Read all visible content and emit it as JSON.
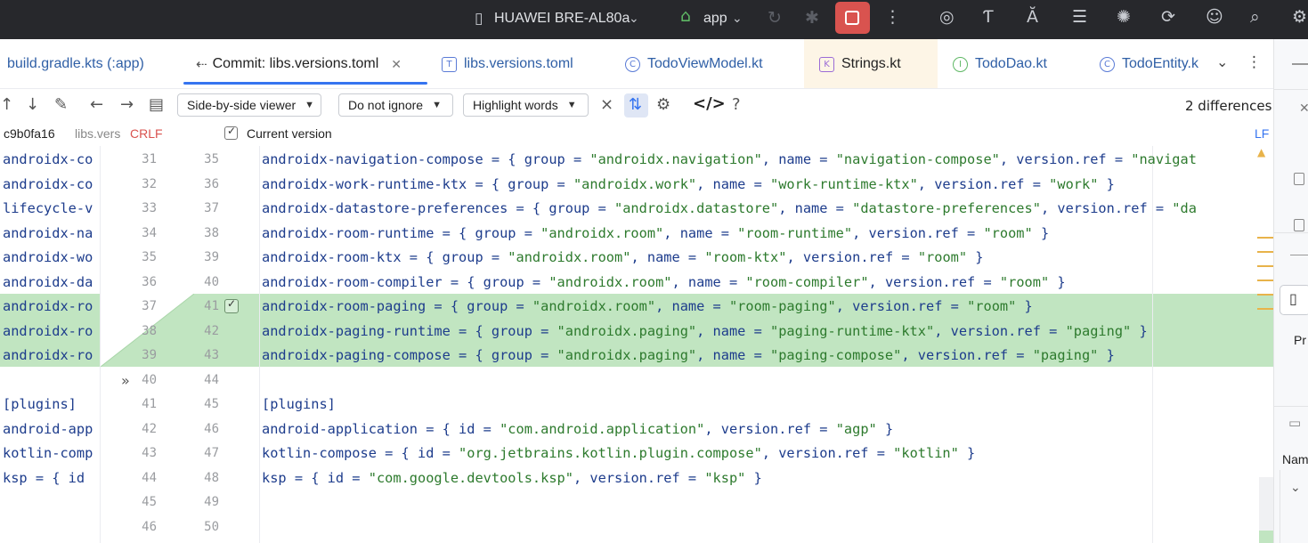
{
  "titlebar": {
    "device": "HUAWEI BRE-AL80a",
    "run_config": "app"
  },
  "tabs": [
    {
      "label": "build.gradle.kts (:app)"
    },
    {
      "label": "Commit: libs.versions.toml"
    },
    {
      "label": "libs.versions.toml"
    },
    {
      "label": "TodoViewModel.kt"
    },
    {
      "label": "Strings.kt"
    },
    {
      "label": "TodoDao.kt"
    },
    {
      "label": "TodoEntity.k"
    }
  ],
  "toolbar": {
    "viewer": "Side-by-side viewer",
    "whitespace": "Do not ignore",
    "highlight": "Highlight words",
    "help": "?",
    "differences": "2 differences"
  },
  "info": {
    "left_hash": "c9b0fa16",
    "left_file": "libs.vers",
    "left_eol": "CRLF",
    "right_label": "Current version",
    "right_eol": "LF"
  },
  "left_lines": [
    {
      "num": "31",
      "text": "androidx-co"
    },
    {
      "num": "32",
      "text": "androidx-co"
    },
    {
      "num": "33",
      "text": "lifecycle-v"
    },
    {
      "num": "34",
      "text": "androidx-na"
    },
    {
      "num": "35",
      "text": "androidx-wo"
    },
    {
      "num": "36",
      "text": "androidx-da"
    },
    {
      "num": "37",
      "text": "androidx-ro"
    },
    {
      "num": "38",
      "text": "androidx-ro"
    },
    {
      "num": "39",
      "text": "androidx-ro"
    },
    {
      "num": "40",
      "text": ""
    },
    {
      "num": "41",
      "text": "[plugins]"
    },
    {
      "num": "42",
      "text": "android-app"
    },
    {
      "num": "43",
      "text": "kotlin-comp"
    },
    {
      "num": "44",
      "text": "ksp = { id "
    },
    {
      "num": "45",
      "text": ""
    },
    {
      "num": "46",
      "text": ""
    }
  ],
  "right_lines": [
    {
      "num": "35",
      "added": false,
      "text": "androidx-navigation-compose = { group = \"androidx.navigation\", name = \"navigation-compose\", version.ref = \"navigat"
    },
    {
      "num": "36",
      "added": false,
      "text": "androidx-work-runtime-ktx = { group = \"androidx.work\", name = \"work-runtime-ktx\", version.ref = \"work\" }"
    },
    {
      "num": "37",
      "added": false,
      "text": "androidx-datastore-preferences = { group = \"androidx.datastore\", name = \"datastore-preferences\", version.ref = \"da"
    },
    {
      "num": "38",
      "added": false,
      "text": "androidx-room-runtime = { group = \"androidx.room\", name = \"room-runtime\", version.ref = \"room\" }"
    },
    {
      "num": "39",
      "added": false,
      "text": "androidx-room-ktx = { group = \"androidx.room\", name = \"room-ktx\", version.ref = \"room\" }"
    },
    {
      "num": "40",
      "added": false,
      "text": "androidx-room-compiler = { group = \"androidx.room\", name = \"room-compiler\", version.ref = \"room\" }"
    },
    {
      "num": "41",
      "added": true,
      "text": "androidx-room-paging = { group = \"androidx.room\", name = \"room-paging\", version.ref = \"room\" }"
    },
    {
      "num": "42",
      "added": true,
      "text": "androidx-paging-runtime = { group = \"androidx.paging\", name = \"paging-runtime-ktx\", version.ref = \"paging\" }"
    },
    {
      "num": "43",
      "added": true,
      "text": "androidx-paging-compose = { group = \"androidx.paging\", name = \"paging-compose\", version.ref = \"paging\" }"
    },
    {
      "num": "44",
      "added": false,
      "text": ""
    },
    {
      "num": "45",
      "added": false,
      "text": "[plugins]"
    },
    {
      "num": "46",
      "added": false,
      "text": "android-application = { id = \"com.android.application\", version.ref = \"agp\" }"
    },
    {
      "num": "47",
      "added": false,
      "text": "kotlin-compose = { id = \"org.jetbrains.kotlin.plugin.compose\", version.ref = \"kotlin\" }"
    },
    {
      "num": "48",
      "added": false,
      "text": "ksp = { id = \"com.google.devtools.ksp\", version.ref = \"ksp\" }"
    },
    {
      "num": "49",
      "added": false,
      "text": ""
    },
    {
      "num": "50",
      "added": false,
      "text": ""
    }
  ],
  "right_panel": {
    "label_pr": "Pr",
    "label_nam": "Nam"
  },
  "colors": {
    "added_bg": "#c1e5c1",
    "titlebar_bg": "#27282c",
    "stop_button": "#d9534f",
    "string": "#2d7a2d",
    "keyword_blue": "#1d3c8c",
    "crlf": "#d9534f"
  }
}
